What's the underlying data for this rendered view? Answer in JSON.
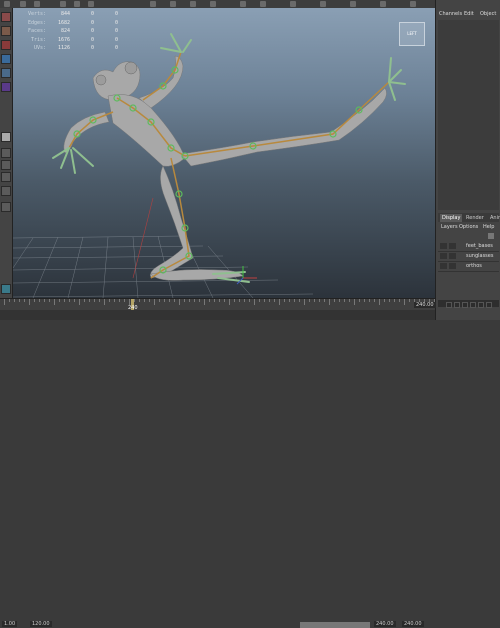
{
  "hud": {
    "rows": [
      {
        "label": "Verts:",
        "val": "844",
        "a": "0",
        "b": "0"
      },
      {
        "label": "Edges:",
        "val": "1682",
        "a": "0",
        "b": "0"
      },
      {
        "label": "Faces:",
        "val": "824",
        "a": "0",
        "b": "0"
      },
      {
        "label": "Tris:",
        "val": "1676",
        "a": "0",
        "b": "0"
      },
      {
        "label": "UVs:",
        "val": "1126",
        "a": "0",
        "b": "0"
      }
    ]
  },
  "viewcube_label": "LEFT",
  "channel_box": {
    "tabs": [
      "Channels",
      "Edit",
      "Object"
    ]
  },
  "panel_tabs": [
    "Display",
    "Render",
    "Anim"
  ],
  "layer_menu": [
    "Layers",
    "Options",
    "Help"
  ],
  "layers": [
    {
      "name": "feet_bases"
    },
    {
      "name": "sunglasses"
    },
    {
      "name": "orthos"
    }
  ],
  "timeline": {
    "current_frame": "240",
    "end_frame": "240.00",
    "range_start": "1.00",
    "range_start2": "120.00",
    "range_end": "240.00",
    "range_end2": "240.00"
  },
  "colors": {
    "joint": "#5dbb5d",
    "bone": "#b8893d",
    "mesh": "#a8a8a8"
  }
}
